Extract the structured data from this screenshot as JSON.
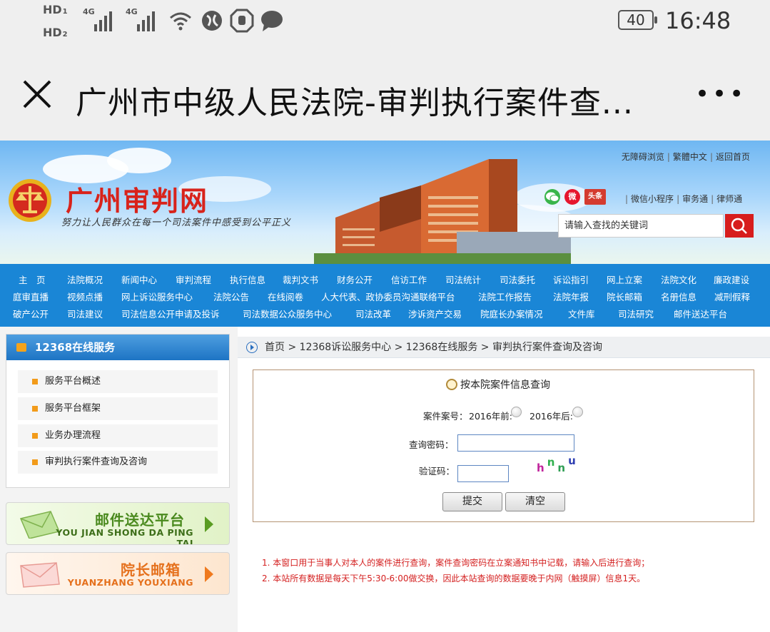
{
  "status_bar": {
    "hd1": "HD",
    "hd1_sub": "1",
    "hd2": "HD",
    "hd2_sub": "2",
    "net1": "4G",
    "net2": "4G",
    "battery": "40",
    "time": "16:48"
  },
  "titlebar": {
    "title": "广州市中级人民法院-审判执行案件查...",
    "more": "•••"
  },
  "header": {
    "site_name": "广州审判网",
    "slogan": "努力让人民群众在每一个司法案件中感受到公平正义",
    "top_links": [
      "无障碍浏览",
      "繁體中文",
      "返回首页"
    ],
    "social_weibo": "微",
    "social_toutiao": "头条",
    "sub_links": [
      "微信小程序",
      "审务通",
      "律师通"
    ],
    "search_placeholder": "请输入查找的关键词"
  },
  "nav": {
    "row1": [
      "主　页",
      "法院概况",
      "新闻中心",
      "审判流程",
      "执行信息",
      "裁判文书",
      "财务公开",
      "信访工作",
      "司法统计",
      "司法委托",
      "诉讼指引",
      "网上立案",
      "法院文化",
      "廉政建设"
    ],
    "row2": [
      "庭审直播",
      "视频点播",
      "网上诉讼服务中心",
      "法院公告",
      "在线阅卷",
      "人大代表、政协委员沟通联络平台",
      "法院工作报告",
      "法院年报",
      "院长邮箱",
      "名册信息",
      "减刑假释"
    ],
    "row3": [
      "破产公开",
      "司法建议",
      "司法信息公开申请及投诉",
      "司法数据公众服务中心",
      "司法改革",
      "涉诉资产交易",
      "院庭长办案情况",
      "文件库",
      "司法研究",
      "邮件送达平台"
    ]
  },
  "sidebar": {
    "heading": "12368在线服务",
    "items": [
      "服务平台概述",
      "服务平台框架",
      "业务办理流程",
      "审判执行案件查询及咨询"
    ],
    "promo1": {
      "title": "邮件送达平台",
      "subtitle": "YOU JIAN SHONG DA PING TAI"
    },
    "promo2": {
      "title": "院长邮箱",
      "subtitle": "YUANZHANG YOUXIANG"
    }
  },
  "breadcrumb": "首页 > 12368诉讼服务中心 > 12368在线服务 > 审判执行案件查询及咨询",
  "form": {
    "title": "按本院案件信息查询",
    "case_no_label": "案件案号：",
    "before_2016": "2016年前:",
    "after_2016": "2016年后:",
    "password_label": "查询密码：",
    "captcha_label": "验证码：",
    "captcha": [
      "h",
      "n",
      "n",
      "u"
    ],
    "submit": "提交",
    "clear": "清空"
  },
  "notes": [
    "1. 本窗口用于当事人对本人的案件进行查询，案件查询密码在立案通知书中记载，请输入后进行查询；",
    "2. 本站所有数据是每天下午5:30-6:00做交换，因此本站查询的数据要晚于内网（触摸屏）信息1天。"
  ],
  "colors": {
    "nav_blue": "#1a86d6",
    "brand_red": "#d8231b",
    "note_red": "#d42020",
    "promo_green": "#4a8a1e",
    "promo_orange": "#e5701c"
  }
}
